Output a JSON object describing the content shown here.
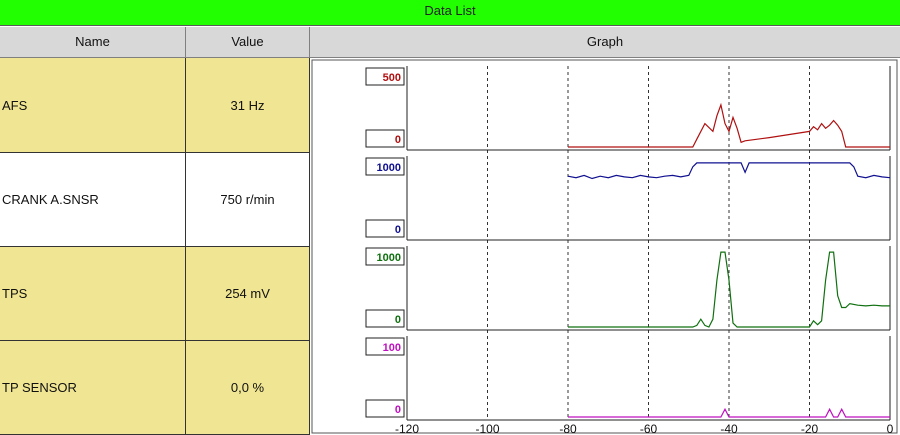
{
  "window": {
    "title": "Data List"
  },
  "columns": {
    "name": "Name",
    "value": "Value",
    "graph": "Graph"
  },
  "rows": [
    {
      "name": "AFS",
      "value": "31 Hz",
      "highlight": true
    },
    {
      "name": "CRANK A.SNSR",
      "value": "750 r/min",
      "highlight": false
    },
    {
      "name": "TPS",
      "value": "254 mV",
      "highlight": true
    },
    {
      "name": "TP SENSOR",
      "value": "0,0 %",
      "highlight": true
    }
  ],
  "chart_data": {
    "type": "line",
    "xlim": [
      -120,
      0
    ],
    "x_ticks": [
      "-120",
      "-100",
      "-80",
      "-60",
      "-40",
      "-20",
      "0"
    ],
    "grid": "vertical dashed",
    "panels": [
      {
        "series": "AFS",
        "color": "#b01010",
        "max_label": "500",
        "min_label": "0",
        "ylim": [
          0,
          500
        ],
        "points": [
          [
            -80,
            0
          ],
          [
            -49,
            0
          ],
          [
            -48,
            50
          ],
          [
            -46,
            150
          ],
          [
            -44,
            100
          ],
          [
            -43,
            200
          ],
          [
            -42,
            270
          ],
          [
            -41,
            150
          ],
          [
            -40,
            100
          ],
          [
            -39,
            190
          ],
          [
            -38,
            120
          ],
          [
            -37,
            30
          ],
          [
            -36,
            40
          ],
          [
            -30,
            60
          ],
          [
            -25,
            80
          ],
          [
            -20,
            100
          ],
          [
            -19,
            130
          ],
          [
            -18,
            110
          ],
          [
            -17,
            150
          ],
          [
            -16,
            120
          ],
          [
            -15,
            140
          ],
          [
            -14,
            170
          ],
          [
            -13,
            140
          ],
          [
            -12,
            100
          ],
          [
            -11,
            0
          ],
          [
            0,
            0
          ]
        ]
      },
      {
        "series": "CRANK A.SNSR",
        "color": "#101090",
        "max_label": "1000",
        "min_label": "0",
        "ylim": [
          0,
          1000
        ],
        "points": [
          [
            -80,
            780
          ],
          [
            -78,
            760
          ],
          [
            -76,
            790
          ],
          [
            -74,
            750
          ],
          [
            -72,
            780
          ],
          [
            -70,
            760
          ],
          [
            -68,
            790
          ],
          [
            -66,
            770
          ],
          [
            -64,
            760
          ],
          [
            -62,
            790
          ],
          [
            -60,
            770
          ],
          [
            -58,
            760
          ],
          [
            -56,
            780
          ],
          [
            -54,
            790
          ],
          [
            -52,
            770
          ],
          [
            -50,
            790
          ],
          [
            -49,
            900
          ],
          [
            -48,
            950
          ],
          [
            -38,
            950
          ],
          [
            -37,
            950
          ],
          [
            -36,
            830
          ],
          [
            -35,
            950
          ],
          [
            -10,
            950
          ],
          [
            -9,
            900
          ],
          [
            -8,
            780
          ],
          [
            -6,
            760
          ],
          [
            -4,
            790
          ],
          [
            -2,
            770
          ],
          [
            0,
            760
          ]
        ]
      },
      {
        "series": "TPS",
        "color": "#107010",
        "max_label": "1000",
        "min_label": "0",
        "ylim": [
          0,
          1000
        ],
        "points": [
          [
            -80,
            0
          ],
          [
            -49,
            0
          ],
          [
            -48,
            20
          ],
          [
            -47,
            100
          ],
          [
            -46,
            20
          ],
          [
            -45,
            0
          ],
          [
            -44,
            100
          ],
          [
            -43,
            600
          ],
          [
            -42,
            960
          ],
          [
            -41,
            960
          ],
          [
            -40,
            600
          ],
          [
            -39,
            50
          ],
          [
            -38,
            0
          ],
          [
            -20,
            0
          ],
          [
            -19,
            80
          ],
          [
            -18,
            30
          ],
          [
            -17,
            80
          ],
          [
            -16,
            600
          ],
          [
            -15,
            960
          ],
          [
            -14,
            960
          ],
          [
            -13,
            400
          ],
          [
            -12,
            250
          ],
          [
            -11,
            250
          ],
          [
            -10,
            300
          ],
          [
            -8,
            280
          ],
          [
            -6,
            270
          ],
          [
            -4,
            280
          ],
          [
            -2,
            270
          ],
          [
            0,
            270
          ]
        ]
      },
      {
        "series": "TP SENSOR",
        "color": "#c010c0",
        "max_label": "100",
        "min_label": "0",
        "ylim": [
          0,
          100
        ],
        "points": [
          [
            -80,
            0
          ],
          [
            -42,
            0
          ],
          [
            -41,
            10
          ],
          [
            -40,
            0
          ],
          [
            -39,
            0
          ],
          [
            -16,
            0
          ],
          [
            -15,
            10
          ],
          [
            -14,
            0
          ],
          [
            -13,
            0
          ],
          [
            -12,
            10
          ],
          [
            -11,
            0
          ],
          [
            0,
            0
          ]
        ]
      }
    ]
  }
}
